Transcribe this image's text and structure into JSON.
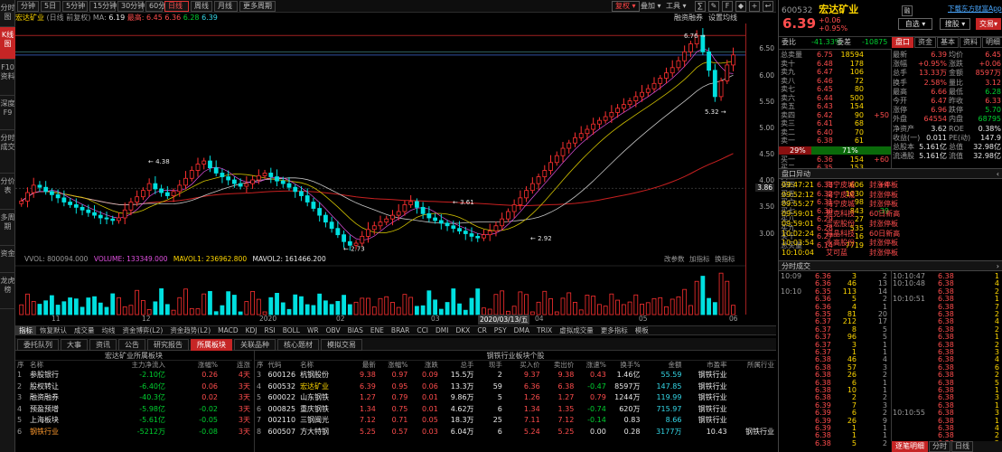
{
  "left_tabs": [
    {
      "label": "分时图",
      "active": false
    },
    {
      "label": "K线图",
      "active": true
    },
    {
      "label": "F10资料",
      "active": false
    },
    {
      "label": "深度F9",
      "active": false
    },
    {
      "label": "分时成交",
      "active": false
    },
    {
      "label": "分价表",
      "active": false
    },
    {
      "label": "多周期",
      "active": false
    },
    {
      "label": "资金",
      "active": false
    },
    {
      "label": "龙虎榜",
      "active": false
    }
  ],
  "toolbar": {
    "periods": [
      "分钟",
      "5日",
      "5分钟",
      "15分钟",
      "30分钟",
      "60分钟",
      "日线",
      "周线",
      "月线",
      "更多周期"
    ],
    "active_period": "日线",
    "adjust": "复权",
    "add": "叠加",
    "tools": "工具",
    "icon_labels": [
      "统计",
      "画线",
      "F10",
      "标记",
      "+自选",
      "返回"
    ]
  },
  "info": {
    "name": "宏达矿业",
    "mode": "(日线 前复权)",
    "ma_label": "MA:",
    "price": "6.19",
    "high_text": "最高: 6.45",
    "low_text": "6.36",
    "ma2_text": "6.28",
    "ma3_text": "6.39",
    "trend": "融资融券",
    "settings": "设置均线"
  },
  "chart_data": {
    "type": "candlestick",
    "title": "宏达矿业 (日线 前复权)",
    "y_ticks": [
      "6.50",
      "6.00",
      "5.50",
      "5.00",
      "4.50",
      "4.00",
      "3.50",
      "3.00"
    ],
    "ylim": [
      2.7,
      6.85
    ],
    "current_price": "3.86",
    "x_ticks": [
      "11",
      "12",
      "2020",
      "02",
      "03",
      "2020/03/13/五",
      "04",
      "05",
      "06"
    ],
    "annotations": {
      "high": "6.76",
      "low1": "2.73",
      "low2": "2.92",
      "low3": "5.32",
      "mark1": "4.38",
      "mark2": "3.61"
    },
    "close": [
      3.62,
      3.78,
      3.92,
      3.88,
      3.8,
      3.74,
      3.68,
      3.6,
      3.55,
      3.5,
      3.45,
      3.4,
      3.35,
      3.3,
      3.28,
      3.25,
      3.3,
      3.45,
      3.6,
      3.7,
      3.82,
      3.95,
      3.85,
      3.78,
      3.72,
      3.8,
      3.92,
      4.05,
      4.2,
      4.32,
      4.38,
      4.25,
      4.15,
      4.08,
      4.02,
      3.95,
      3.9,
      3.95,
      4.02,
      4.1,
      4.15,
      4.08,
      4.0,
      3.95,
      3.88,
      3.8,
      3.72,
      3.6,
      3.48,
      3.35,
      3.22,
      3.1,
      2.98,
      2.85,
      2.78,
      2.82,
      2.95,
      3.08,
      3.15,
      3.22,
      3.28,
      3.35,
      3.42,
      3.55,
      3.61,
      3.5,
      3.38,
      3.3,
      3.25,
      3.2,
      3.15,
      3.1,
      3.05,
      3.0,
      2.95,
      2.92,
      2.98,
      3.05,
      3.15,
      3.28,
      3.42,
      3.55,
      3.68,
      3.82,
      3.95,
      4.08,
      4.2,
      4.35,
      4.48,
      4.62,
      4.72,
      4.82,
      4.9,
      4.98,
      5.08,
      5.15,
      5.22,
      5.3,
      5.38,
      5.45,
      5.52,
      5.6,
      5.68,
      5.75,
      5.85,
      5.95,
      6.05,
      6.15,
      6.28,
      6.45,
      6.6,
      6.76,
      6.45,
      6.1,
      5.6,
      5.9,
      6.2,
      6.39
    ],
    "volume_labels": {
      "vvol": "VVOL: 800094.000",
      "volume": "VOLUME: 133349.000",
      "mavol1": "MAVOL1: 236962.800",
      "mavol2": "MAVOL2: 161466.200"
    },
    "volume_right": [
      "改参数",
      "加指标",
      "换指标"
    ]
  },
  "indicators": [
    "指标",
    "恢复默认",
    "成交量",
    "均线",
    "资金博弈(L2)",
    "资金趋势(L2)",
    "MACD",
    "KDJ",
    "RSI",
    "BOLL",
    "WR",
    "OBV",
    "BIAS",
    "ENE",
    "BRAR",
    "CCI",
    "DMI",
    "DKX",
    "CR",
    "PSY",
    "DMA",
    "TRIX",
    "虚拟成交量",
    "更多指标",
    "模板"
  ],
  "bottom_tabs": [
    "委托队列",
    "大事",
    "资讯",
    "公告",
    "研究报告",
    "所属板块",
    "关联品种",
    "核心题材",
    "模拟交易"
  ],
  "active_bottom_tab": "所属板块",
  "sector_panel": {
    "title": "宏达矿业所属板块",
    "headers": [
      "序",
      "名称",
      "主力净流入",
      "涨幅%",
      "连涨"
    ],
    "rows": [
      [
        "1",
        "参股银行",
        "-2.10亿",
        "0.26",
        "4天"
      ],
      [
        "2",
        "股权转让",
        "-6.40亿",
        "0.06",
        "3天"
      ],
      [
        "3",
        "融资融券",
        "-40.3亿",
        "0.02",
        "3天"
      ],
      [
        "4",
        "预盈预增",
        "-5.98亿",
        "-0.02",
        "3天"
      ],
      [
        "5",
        "上海板块",
        "-5.61亿",
        "-0.05",
        "3天"
      ],
      [
        "6",
        "钢铁行业",
        "-5212万",
        "-0.08",
        "3天"
      ]
    ]
  },
  "steel_panel": {
    "title": "钢铁行业板块个股",
    "headers": [
      "序",
      "代码",
      "名称",
      "最新",
      "涨幅%",
      "涨跌",
      "总手",
      "现手",
      "买入价",
      "卖出价",
      "涨速%",
      "换手%",
      "金额",
      "市盈率",
      "所属行业"
    ],
    "rows": [
      [
        "3",
        "600126",
        "杭钢股份",
        "9.38",
        "0.97",
        "0.09",
        "15.5万",
        "2",
        "9.37",
        "9.38",
        "0.43",
        "1.46亿",
        "55.59",
        "钢铁行业"
      ],
      [
        "4",
        "600532",
        "宏达矿业",
        "6.39",
        "0.95",
        "0.06",
        "13.3万",
        "59",
        "6.36",
        "6.38",
        "-0.47",
        "8597万",
        "147.85",
        "钢铁行业"
      ],
      [
        "5",
        "600022",
        "山东钢铁",
        "1.27",
        "0.79",
        "0.01",
        "9.86万",
        "5",
        "1.26",
        "1.27",
        "0.79",
        "1244万",
        "119.99",
        "钢铁行业"
      ],
      [
        "6",
        "000825",
        "重庆钢铁",
        "1.34",
        "0.75",
        "0.01",
        "4.62万",
        "6",
        "1.34",
        "1.35",
        "-0.74",
        "620万",
        "715.97",
        "钢铁行业"
      ],
      [
        "7",
        "002110",
        "三钢闽光",
        "7.12",
        "0.71",
        "0.05",
        "18.3万",
        "25",
        "7.11",
        "7.12",
        "-0.14",
        "0.83",
        "8.66",
        "钢铁行业"
      ],
      [
        "8",
        "600507",
        "方大特钢",
        "5.25",
        "0.57",
        "0.03",
        "6.04万",
        "6",
        "5.24",
        "5.25",
        "0.00",
        "0.28",
        "3177万",
        "10.43",
        "钢铁行业"
      ]
    ]
  },
  "quote": {
    "code": "600532",
    "name": "宏达矿业",
    "price": "6.39",
    "change": "+0.06",
    "pct": "+0.95%",
    "buttons": [
      "自选",
      "搜股",
      "交易"
    ],
    "app_link": "下载东方财富App",
    "weibi": "委比",
    "weibi_val": "-41.33%",
    "weicha": "委差",
    "weicha_val": "-10875",
    "sells": [
      [
        "总卖量",
        "6.75",
        "18594"
      ],
      [
        "卖十",
        "6.48",
        "178"
      ],
      [
        "卖九",
        "6.47",
        "106"
      ],
      [
        "卖八",
        "6.46",
        "72"
      ],
      [
        "卖七",
        "6.45",
        "80"
      ],
      [
        "卖六",
        "6.44",
        "500"
      ],
      [
        "卖五",
        "6.43",
        "154"
      ],
      [
        "卖四",
        "6.42",
        "90"
      ],
      [
        "卖三",
        "6.41",
        "68"
      ],
      [
        "卖二",
        "6.40",
        "70"
      ],
      [
        "卖一",
        "6.38",
        "61"
      ]
    ],
    "sell_changes": [
      "",
      "",
      "",
      "",
      "",
      "",
      "",
      "+50",
      "",
      "",
      ""
    ],
    "ratio": [
      "29%",
      "71%"
    ],
    "buys": [
      [
        "买一",
        "6.36",
        "154"
      ],
      [
        "买二",
        "6.35",
        "153"
      ],
      [
        "买三",
        "6.34",
        "125"
      ],
      [
        "买四",
        "6.33",
        "606"
      ],
      [
        "买五",
        "6.32",
        "1030"
      ],
      [
        "买六",
        "6.31",
        "98"
      ],
      [
        "买七",
        "6.30",
        "843"
      ],
      [
        "买八",
        "6.29",
        "27"
      ],
      [
        "买九",
        "6.28",
        "535"
      ],
      [
        "买十",
        "6.27",
        "16"
      ],
      [
        "总买量",
        "6.14",
        "7719"
      ]
    ],
    "buy_changes": [
      "+60",
      "",
      "",
      "+4",
      "",
      "",
      "-39",
      "",
      "",
      "",
      ""
    ],
    "tabs": [
      "盘口",
      "资金",
      "基本",
      "资料",
      "明细",
      "逐笔"
    ],
    "stats": [
      [
        "最新",
        "6.39",
        "均价",
        "6.45"
      ],
      [
        "涨幅",
        "+0.95%",
        "涨跌",
        "+0.06"
      ],
      [
        "总手",
        "13.33万",
        "金额",
        "8597万"
      ],
      [
        "换手",
        "2.58%",
        "量比",
        "3.12"
      ],
      [
        "最高",
        "6.66",
        "最低",
        "6.28"
      ],
      [
        "今开",
        "6.47",
        "昨收",
        "6.33"
      ],
      [
        "涨停",
        "6.96",
        "跌停",
        "5.70"
      ],
      [
        "外盘",
        "64554",
        "内盘",
        "68795"
      ],
      [
        "净资产",
        "3.62",
        "ROE",
        "0.38%"
      ],
      [
        "收益(一)",
        "0.011",
        "PE(动)",
        "147.9"
      ],
      [
        "总股本",
        "5.161亿",
        "总值",
        "32.98亿"
      ],
      [
        "流通股",
        "5.161亿",
        "流值",
        "32.98亿"
      ]
    ],
    "pankou_title": "盘口异动",
    "alerts": [
      [
        "09:47:21",
        "海宁皮城",
        "封涨停板"
      ],
      [
        "09:52:12",
        "海宁皮城",
        "封涨停板"
      ],
      [
        "09:55:27",
        "海宁皮城",
        "封涨停板"
      ],
      [
        "09:59:01",
        "雅克科技",
        "60日新高"
      ],
      [
        "09:59:01",
        "吉宏股份",
        "封涨停板"
      ],
      [
        "10:02:24",
        "福晶科技",
        "60日新高"
      ],
      [
        "10:03:54",
        "永高股份",
        "封涨停板"
      ],
      [
        "10:10:04",
        "艾可蓝",
        "封涨停板"
      ]
    ],
    "fenshi_title": "分时成交",
    "trades_left": [
      [
        "10:09",
        "6.36",
        "3",
        "2"
      ],
      [
        "",
        "6.36",
        "46",
        "13"
      ],
      [
        "10:10",
        "6.35",
        "113",
        "14"
      ],
      [
        "",
        "6.36",
        "5",
        "2"
      ],
      [
        "",
        "6.36",
        "4",
        "1"
      ],
      [
        "",
        "6.35",
        "81",
        "20"
      ],
      [
        "",
        "6.37",
        "212",
        "17"
      ],
      [
        "",
        "6.37",
        "8",
        "5"
      ],
      [
        "",
        "6.37",
        "96",
        "5"
      ],
      [
        "",
        "6.37",
        "3",
        "1"
      ],
      [
        "",
        "6.37",
        "1",
        "1"
      ],
      [
        "",
        "6.38",
        "46",
        "4"
      ],
      [
        "",
        "6.38",
        "57",
        "3"
      ],
      [
        "",
        "6.38",
        "26",
        "2"
      ],
      [
        "",
        "6.38",
        "6",
        "1"
      ],
      [
        "",
        "6.38",
        "10",
        "1"
      ],
      [
        "",
        "6.38",
        "2",
        "2"
      ],
      [
        "",
        "6.39",
        "7",
        "3"
      ],
      [
        "",
        "6.39",
        "6",
        "2"
      ],
      [
        "",
        "6.39",
        "26",
        "9"
      ],
      [
        "",
        "6.39",
        "1",
        "1"
      ],
      [
        "",
        "6.38",
        "1",
        "1"
      ],
      [
        "",
        "6.38",
        "5",
        "2"
      ]
    ],
    "trades_right": [
      [
        "10:10:47",
        "6.38",
        "1"
      ],
      [
        "10:10:48",
        "6.38",
        "4"
      ],
      [
        "",
        "6.38",
        "2"
      ],
      [
        "10:10:51",
        "6.38",
        "1"
      ],
      [
        "",
        "6.38",
        "7"
      ],
      [
        "",
        "6.38",
        "2"
      ],
      [
        "",
        "6.38",
        "4"
      ],
      [
        "",
        "6.38",
        "2"
      ],
      [
        "",
        "6.38",
        "1"
      ],
      [
        "",
        "6.38",
        "2"
      ],
      [
        "",
        "6.38",
        "3"
      ],
      [
        "",
        "6.38",
        "4"
      ],
      [
        "",
        "6.38",
        "6"
      ],
      [
        "",
        "6.38",
        "2"
      ],
      [
        "",
        "6.38",
        "5"
      ],
      [
        "",
        "6.38",
        "1"
      ],
      [
        "",
        "6.38",
        "3"
      ],
      [
        "",
        "6.38",
        "1"
      ],
      [
        "10:10:55",
        "6.38",
        "3"
      ],
      [
        "",
        "6.38",
        "1"
      ],
      [
        "",
        "6.38",
        "4"
      ],
      [
        "",
        "6.38",
        "2"
      ],
      [
        "",
        "6.38",
        "2"
      ]
    ],
    "bottom_tabs": [
      "逐笔明细",
      "分时",
      "日线"
    ]
  }
}
